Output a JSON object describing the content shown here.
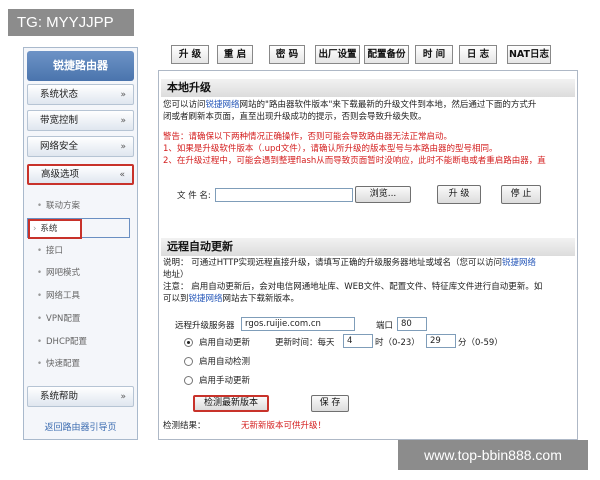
{
  "watermarks": {
    "top_left": "TG: MYYJJPP",
    "bottom_right": "www.top-bbin888.com"
  },
  "sidebar": {
    "title": "锐捷路由器",
    "sections": [
      {
        "label": "系统状态",
        "chevron": "»"
      },
      {
        "label": "带宽控制",
        "chevron": "»"
      },
      {
        "label": "网络安全",
        "chevron": "»"
      },
      {
        "label": "高级选项",
        "chevron": "«"
      }
    ],
    "sub_items": [
      "联动方案",
      "系统",
      "接口",
      "网吧模式",
      "网络工具",
      "VPN配置",
      "DHCP配置",
      "快速配置"
    ],
    "help": {
      "label": "系统帮助",
      "chevron": "»"
    },
    "back_link": "返回路由器引导页"
  },
  "tabs": [
    "升 级",
    "重 启",
    "密 码",
    "出厂设置",
    "配置备份",
    "时 间",
    "日 志",
    "NAT日志"
  ],
  "local_upgrade": {
    "title": "本地升级",
    "desc_line1_a": "您可以访问",
    "desc_line1_link": "锐捷网络",
    "desc_line1_b": "网站的\"路由器软件版本\"来下载最新的升级文件到本地，然后通过下面的方式升",
    "desc_line2": "闭或者刷新本页面，直至出现升级成功的提示，否则会导致升级失败。",
    "warning": "警告：请确保以下两种情况正确操作，否则可能会导致路由器无法正常启动。",
    "warn1": "1、如果是升级软件版本（.upd文件），请确认所升级的版本型号与本路由器的型号相同。",
    "warn2": "2、在升级过程中，可能会遇到整理flash从而导致页面暂时没响应，此时不能断电或者重启路由器，直",
    "file_label": "文 件 名:",
    "file_value": "",
    "browse_label": "浏览...",
    "upgrade_label": "升 级",
    "stop_label": "停 止"
  },
  "remote_update": {
    "title": "远程自动更新",
    "desc_a": "说明：  可通过HTTP实现远程直接升级，请填写正确的升级服务器地址或域名（您可以访问",
    "desc_link": "锐捷网络",
    "desc_b": "地址）",
    "note_a": "注意：  启用自动更新后，会对电信网通地址库、WEB文件、配置文件、特征库文件进行自动更新。如",
    "note_b1": "可以到",
    "note_link": "锐捷网络",
    "note_b2": "网站去下载新版本。",
    "server_label": "远程升级服务器",
    "server_value": "rgos.ruijie.com.cn",
    "port_label": "端口",
    "port_value": "80",
    "opt_auto_update": "启用自动更新",
    "update_time_label": "更新时间：每天",
    "hour_value": "4",
    "hour_range": "时（0-23）",
    "minute_value": "29",
    "minute_range": "分（0-59）",
    "opt_auto_detect": "启用自动检测",
    "opt_manual": "启用手动更新",
    "detect_button": "检测最新版本",
    "save_button": "保 存",
    "result_label": "检测结果：",
    "result_value": "无新新版本可供升级！"
  },
  "colors": {
    "accent_red": "#c8322a",
    "link_blue": "#2456b8",
    "header_blue": "#4a74ad"
  }
}
